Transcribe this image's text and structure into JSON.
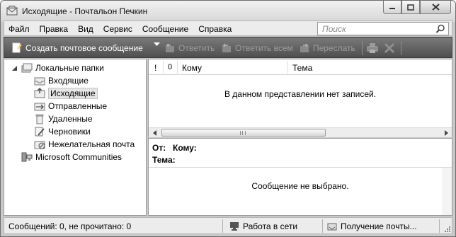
{
  "window": {
    "title": "Исходящие - Почтальон Печкин",
    "app_icon": "mail-app-icon",
    "controls": [
      "minimize-icon",
      "maximize-icon",
      "close-icon"
    ]
  },
  "menu": {
    "items": [
      "Файл",
      "Правка",
      "Вид",
      "Сервис",
      "Сообщение",
      "Справка"
    ],
    "search_placeholder": "Поиск"
  },
  "toolbar": {
    "create_label": "Создать почтовое сообщение",
    "reply_label": "Ответить",
    "reply_all_label": "Ответить всем",
    "forward_label": "Переслать",
    "print_icon": "printer-icon",
    "delete_icon": "delete-icon"
  },
  "folders": {
    "root_label": "Локальные папки",
    "items": [
      {
        "label": "Входящие",
        "icon": "inbox-icon"
      },
      {
        "label": "Исходящие",
        "icon": "outbox-icon",
        "selected": true
      },
      {
        "label": "Отправленные",
        "icon": "sent-icon"
      },
      {
        "label": "Удаленные",
        "icon": "trash-icon"
      },
      {
        "label": "Черновики",
        "icon": "drafts-icon"
      },
      {
        "label": "Нежелательная почта",
        "icon": "junk-icon"
      }
    ],
    "communities_label": "Microsoft Communities"
  },
  "message_list": {
    "columns": {
      "priority": "!",
      "attachment": "0",
      "to": "Кому",
      "subject": "Тема"
    },
    "empty_text": "В данном представлении нет записей."
  },
  "preview": {
    "from_label": "От:",
    "to_label": "Кому:",
    "subject_label": "Тема:",
    "empty_text": "Сообщение не выбрано."
  },
  "status": {
    "counts": "Сообщений: 0, не прочитано: 0",
    "connection": "Работа в сети",
    "receiving": "Получение почты..."
  },
  "colors": {
    "toolbar_bg": "#5f5f5f",
    "frame": "#c9c9c9"
  }
}
